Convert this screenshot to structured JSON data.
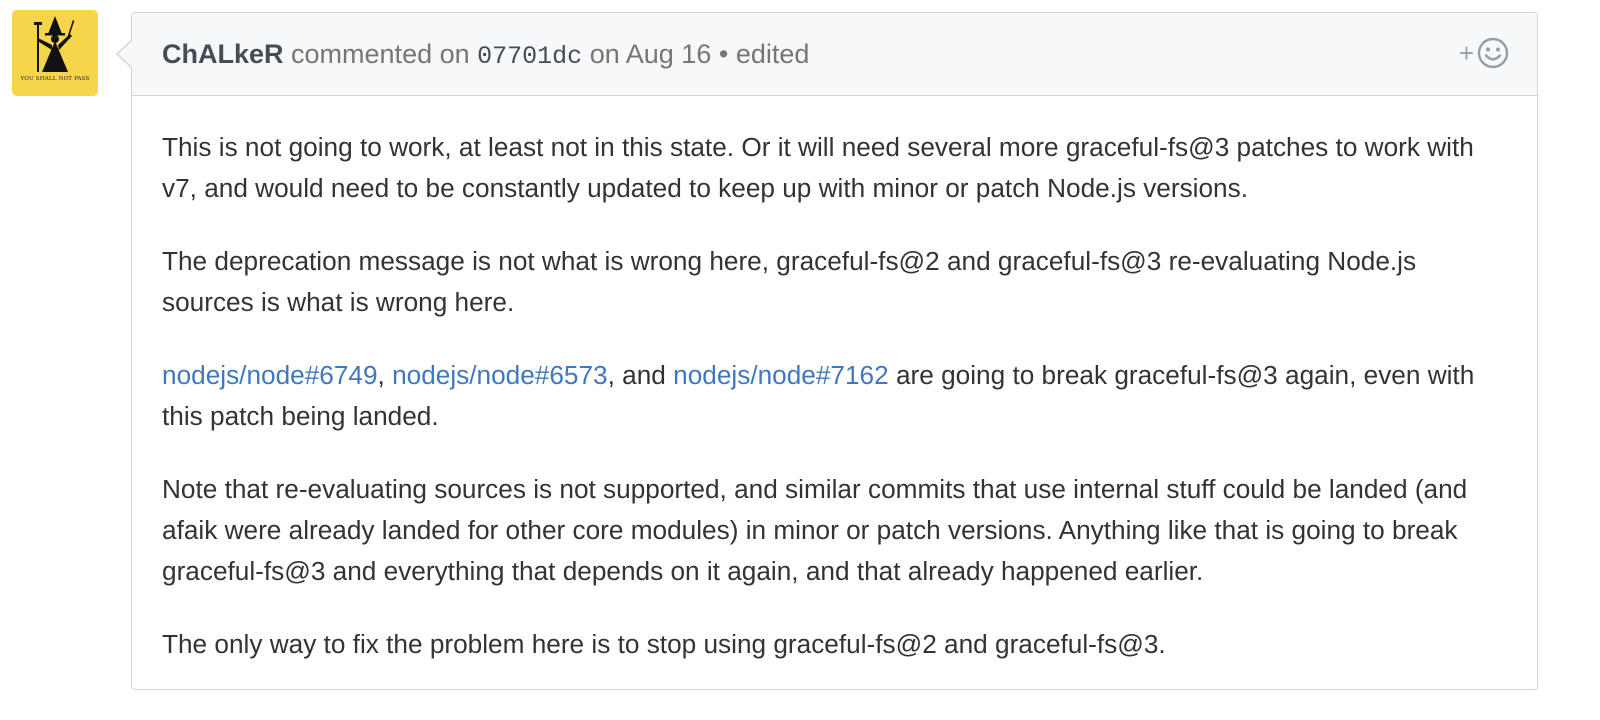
{
  "avatar": {
    "caption": "YOU SHALL NOT PASS"
  },
  "header": {
    "author": "ChALkeR",
    "commented_text": "commented on",
    "commit_sha": "07701dc",
    "on_text": "on",
    "date": "Aug 16",
    "separator": "•",
    "edited": "edited",
    "reaction_plus": "+"
  },
  "body": {
    "p1": "This is not going to work, at least not in this state. Or it will need several more graceful-fs@3 patches to work with v7, and would need to be constantly updated to keep up with minor or patch Node.js versions.",
    "p2": "The deprecation message is not what is wrong here, graceful-fs@2 and graceful-fs@3 re-evaluating Node.js sources is what is wrong here.",
    "p3": {
      "link1": "nodejs/node#6749",
      "sep1": ", ",
      "link2": "nodejs/node#6573",
      "sep2": ", and ",
      "link3": "nodejs/node#7162",
      "rest": " are going to break graceful-fs@3 again, even with this patch being landed."
    },
    "p4": "Note that re-evaluating sources is not supported, and similar commits that use internal stuff could be landed (and afaik were already landed for other core modules) in minor or patch versions. Anything like that is going to break graceful-fs@3 and everything that depends on it again, and that already happened earlier.",
    "p5": "The only way to fix the problem here is to stop using graceful-fs@2 and graceful-fs@3."
  },
  "colors": {
    "link": "#4078c0",
    "avatar_bg": "#f7d54a",
    "header_bg": "#f6f8fa",
    "border": "#d1d5da"
  },
  "icons": {
    "reaction": "smiley-icon"
  }
}
